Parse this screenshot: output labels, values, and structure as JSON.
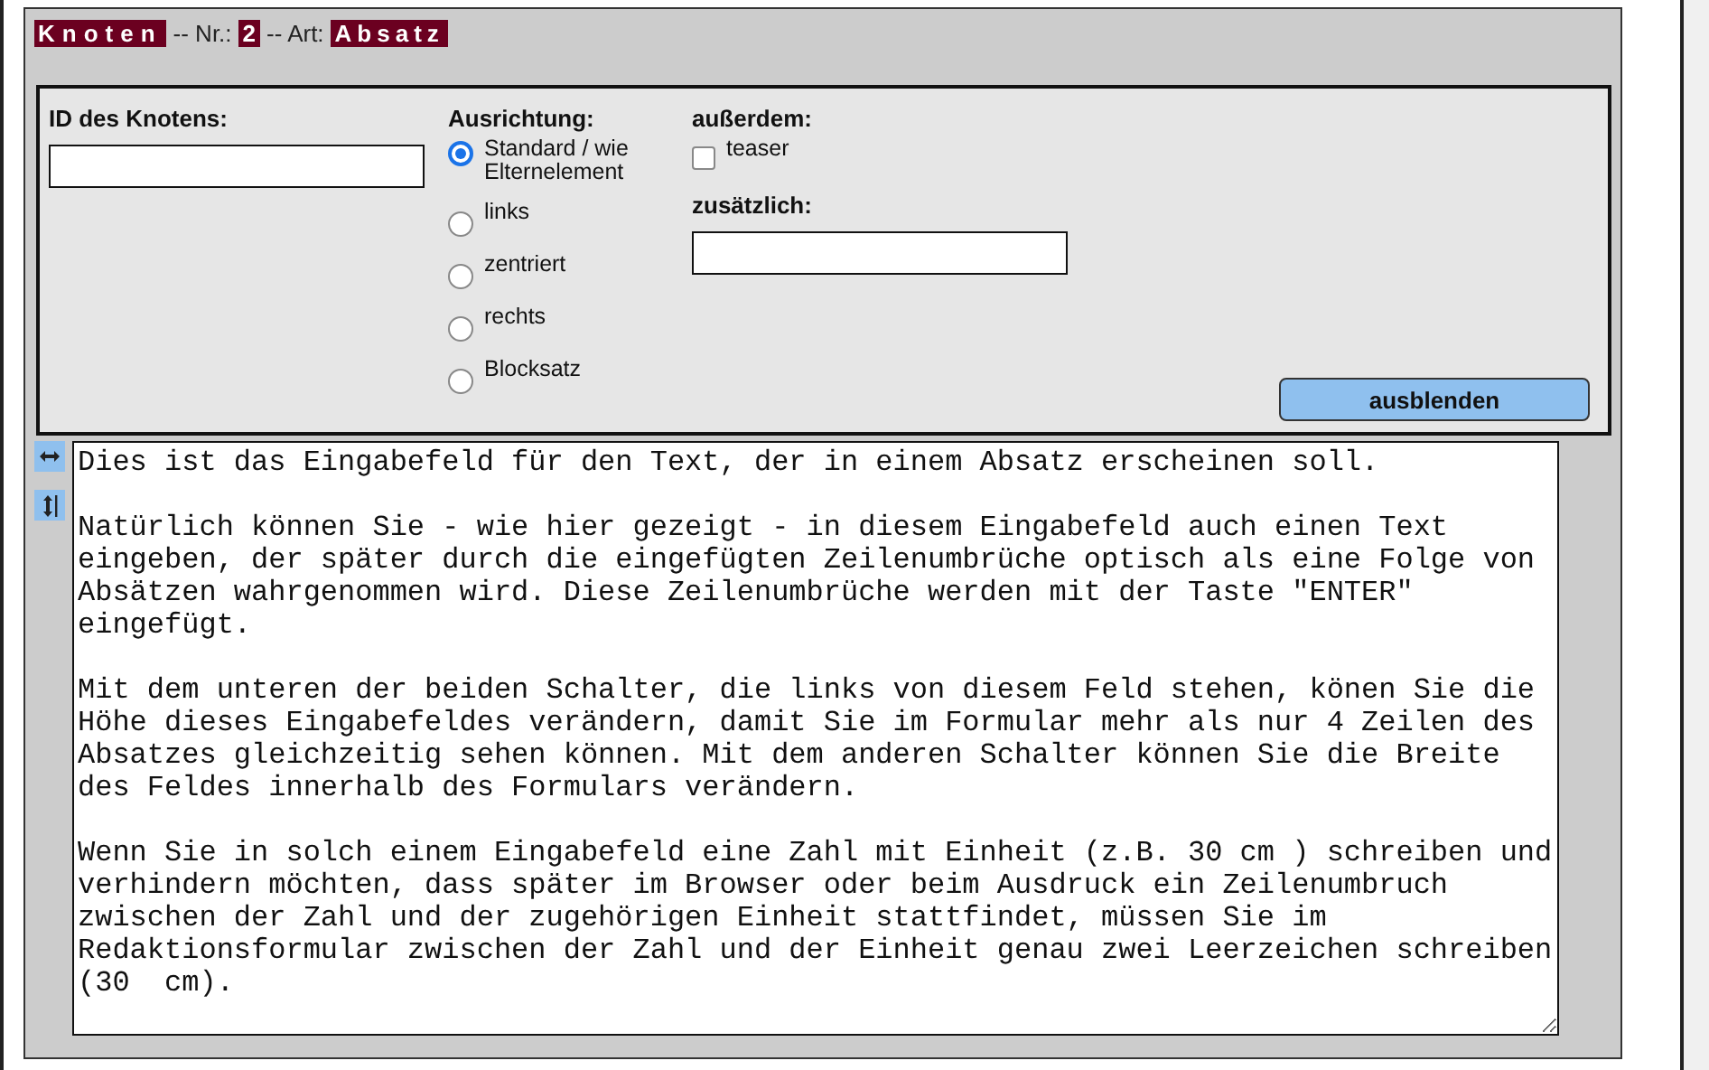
{
  "header": {
    "node_label": "Knoten",
    "nr_label": "-- Nr.:",
    "nr": "2",
    "art_label": "-- Art:",
    "art": "Absatz"
  },
  "id_field": {
    "label": "ID des Knotens:"
  },
  "alignment": {
    "label": "Ausrichtung:",
    "options": [
      {
        "label": "Standard / wie Elternelement",
        "selected": true
      },
      {
        "label": "links",
        "selected": false
      },
      {
        "label": "zentriert",
        "selected": false
      },
      {
        "label": "rechts",
        "selected": false
      },
      {
        "label": "Blocksatz",
        "selected": false
      }
    ]
  },
  "extras": {
    "label": "außerdem:",
    "checkbox": {
      "label": "teaser",
      "checked": false
    },
    "additional_label": "zusätzlich:"
  },
  "hide_button": "ausblenden",
  "text_area": {
    "value": "Dies ist das Eingabefeld für den Text, der in einem Absatz erscheinen soll.\n\nNatürlich können Sie - wie hier gezeigt - in diesem Eingabefeld auch einen Text eingeben, der später durch die eingefügten Zeilenumbrüche optisch als eine Folge von Absätzen wahrgenommen wird. Diese Zeilenumbrüche werden mit der Taste \"ENTER\" eingefügt.\n\nMit dem unteren der beiden Schalter, die links von diesem Feld stehen, könen Sie die Höhe dieses Eingabefeldes verändern, damit Sie im Formular mehr als nur 4 Zeilen des Absatzes gleichzeitig sehen können. Mit dem anderen Schalter können Sie die Breite des Feldes innerhalb des Formulars verändern.\n\nWenn Sie in solch einem Eingabefeld eine Zahl mit Einheit (z.B. 30 cm ) schreiben und verhindern möchten, dass später im Browser oder beim Ausdruck ein Zeilenumbruch zwischen der Zahl und der zugehörigen Einheit stattfindet, müssen Sie im Redaktionsformular zwischen der Zahl und der Einheit genau zwei Leerzeichen schreiben (30  cm)."
  }
}
